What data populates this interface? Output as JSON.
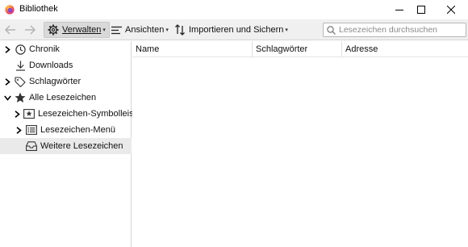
{
  "window": {
    "title": "Bibliothek"
  },
  "toolbar": {
    "manage_label": "Verwalten",
    "views_label": "Ansichten",
    "import_label": "Importieren und Sichern",
    "search_placeholder": "Lesezeichen durchsuchen"
  },
  "sidebar": {
    "items": [
      {
        "label": "Chronik",
        "icon": "clock-icon",
        "expandable": true
      },
      {
        "label": "Downloads",
        "icon": "download-icon",
        "expandable": false
      },
      {
        "label": "Schlagwörter",
        "icon": "tag-icon",
        "expandable": true
      },
      {
        "label": "Alle Lesezeichen",
        "icon": "star-icon",
        "expandable": true,
        "expanded": true
      },
      {
        "label": "Lesezeichen-Symbolleiste",
        "icon": "bookmarks-toolbar-icon",
        "expandable": true
      },
      {
        "label": "Lesezeichen-Menü",
        "icon": "bookmarks-menu-icon",
        "expandable": true
      },
      {
        "label": "Weitere Lesezeichen",
        "icon": "unfiled-bookmarks-icon",
        "expandable": false,
        "selected": true
      }
    ]
  },
  "table": {
    "columns": [
      "Name",
      "Schlagwörter",
      "Adresse"
    ]
  },
  "colors": {
    "toolbar_bg": "#f0f0f0",
    "selected_bg": "#eaeaea",
    "firefox_orange": "#ff7139",
    "firefox_purple": "#9059ff"
  }
}
